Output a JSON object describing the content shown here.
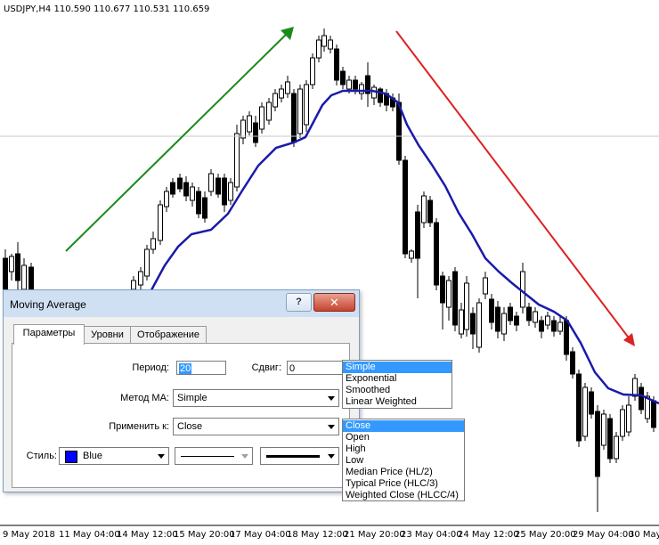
{
  "chart": {
    "title": "USDJPY,H4  110.590 110.677 110.531 110.659",
    "x_labels": [
      "9 May 2018",
      "11 May 04:00",
      "14 May 12:00",
      "15 May 20:00",
      "17 May 04:00",
      "18 May 12:00",
      "21 May 20:00",
      "23 May 04:00",
      "24 May 12:00",
      "25 May 20:00",
      "29 May 04:00",
      "30 May"
    ],
    "colors": {
      "ma_line": "#1a1aaa",
      "up_arrow": "#1a8a1a",
      "down_arrow": "#dd2222",
      "candle": "#000000"
    }
  },
  "chart_data": {
    "type": "candlestick",
    "series": [
      {
        "name": "USDJPY,H4"
      },
      {
        "name": "Moving Average"
      }
    ]
  },
  "dialog": {
    "title": "Moving Average",
    "help_label": "?",
    "close_label": "✕",
    "tabs": [
      {
        "label": "Параметры",
        "active": true
      },
      {
        "label": "Уровни",
        "active": false
      },
      {
        "label": "Отображение",
        "active": false
      }
    ],
    "period_label": "Период:",
    "period_value": "20",
    "shift_label": "Сдвиг:",
    "shift_value": "0",
    "method_label": "Метод MA:",
    "method_value": "Simple",
    "apply_label": "Применить к:",
    "apply_value": "Close",
    "style_label": "Стиль:",
    "color_value": "Blue",
    "color_hex": "#0000ff"
  },
  "method_options": [
    "Simple",
    "Exponential",
    "Smoothed",
    "Linear Weighted"
  ],
  "method_selected": "Simple",
  "apply_options": [
    "Close",
    "Open",
    "High",
    "Low",
    "Median Price (HL/2)",
    "Typical Price (HLC/3)",
    "Weighted Close (HLCC/4)"
  ],
  "apply_selected": "Close"
}
